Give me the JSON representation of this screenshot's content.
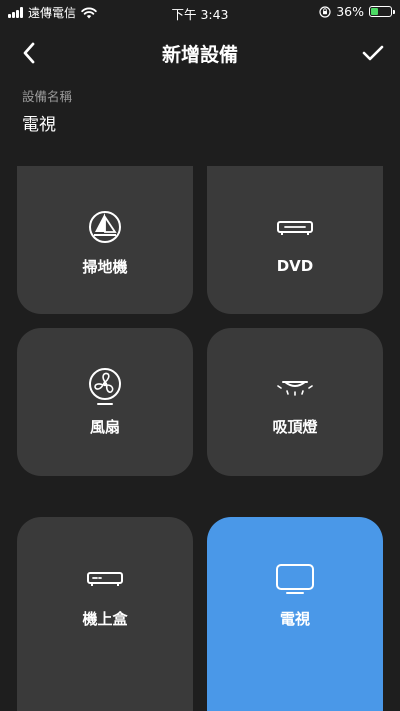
{
  "status_bar": {
    "carrier": "遠傳電信",
    "time": "下午 3:43",
    "battery_percent": "36%",
    "battery_level": 0.36,
    "battery_color": "#4cd964"
  },
  "nav": {
    "title": "新增設備",
    "back_icon": "chevron-left-icon",
    "confirm_icon": "checkmark-icon"
  },
  "device_name": {
    "label": "設備名稱",
    "value": "電視"
  },
  "device_types": [
    {
      "label": "掃地機",
      "icon": "robot-vacuum-icon",
      "selected": false
    },
    {
      "label": "DVD",
      "icon": "dvd-player-icon",
      "selected": false
    },
    {
      "label": "風扇",
      "icon": "fan-icon",
      "selected": false
    },
    {
      "label": "吸頂燈",
      "icon": "ceiling-light-icon",
      "selected": false
    },
    {
      "label": "機上盒",
      "icon": "set-top-box-icon",
      "selected": false
    },
    {
      "label": "電視",
      "icon": "tv-icon",
      "selected": true
    }
  ],
  "colors": {
    "background": "#1e1e1e",
    "tile": "#3a3a3a",
    "tile_selected": "#4a98e8"
  }
}
